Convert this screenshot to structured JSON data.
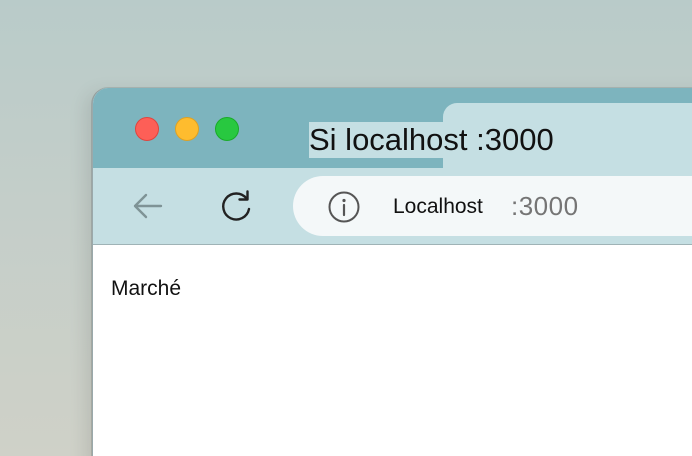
{
  "window": {
    "traffic_lights": [
      {
        "name": "close",
        "color": "#fd5f57"
      },
      {
        "name": "minimize",
        "color": "#febc2e"
      },
      {
        "name": "zoom",
        "color": "#28c840"
      }
    ]
  },
  "tab": {
    "title": "Si localhost :3000"
  },
  "toolbar": {
    "back_icon": "arrow-left-icon",
    "reload_icon": "reload-icon"
  },
  "address_bar": {
    "info_icon": "info-icon",
    "host": "Localhost",
    "port": ":3000"
  },
  "page": {
    "text": "Marché"
  },
  "colors": {
    "titlebar": "#7db4be",
    "toolbar": "#c5dfe3",
    "address_bar": "#f4f8f9"
  }
}
